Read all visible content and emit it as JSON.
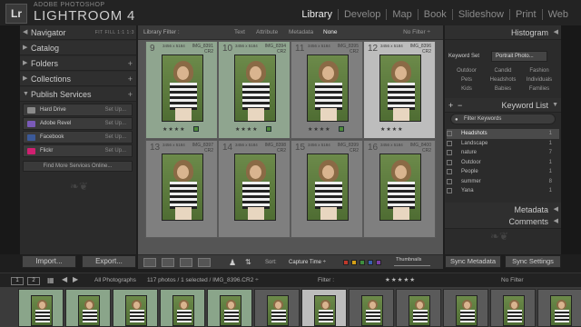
{
  "app": {
    "brand_small": "ADOBE PHOTOSHOP",
    "brand_big": "LIGHTROOM 4",
    "logo": "Lr"
  },
  "modules": [
    "Library",
    "Develop",
    "Map",
    "Book",
    "Slideshow",
    "Print",
    "Web"
  ],
  "active_module": "Library",
  "left_panel": {
    "navigator": {
      "label": "Navigator",
      "options": "FIT   FILL   1:1   1:3"
    },
    "catalog": "Catalog",
    "folders": "Folders",
    "collections": "Collections",
    "publish_services": "Publish Services",
    "services": [
      {
        "name": "Hard Drive",
        "setup": "Set Up...",
        "color": "#8a8a8a"
      },
      {
        "name": "Adobe Revel",
        "setup": "Set Up...",
        "color": "#7a5ab8"
      },
      {
        "name": "Facebook",
        "setup": "Set Up...",
        "color": "#3b5998"
      },
      {
        "name": "Flickr",
        "setup": "Set Up...",
        "color": "#d02070"
      }
    ],
    "find_more": "Find More Services Online...",
    "import": "Import...",
    "export": "Export..."
  },
  "filter_bar": {
    "label": "Library Filter :",
    "tabs": [
      "Text",
      "Attribute",
      "Metadata",
      "None"
    ],
    "active": "None",
    "no_filter": "No Filter ÷"
  },
  "grid": [
    {
      "num": "9",
      "meta": "3456 x 5184",
      "name": "IMG_8391",
      "ext": "CR2",
      "stars": "★★★★",
      "flag": true,
      "style": "green"
    },
    {
      "num": "10",
      "meta": "3456 x 5184",
      "name": "IMG_8394",
      "ext": "CR2",
      "stars": "★★★★",
      "flag": true,
      "style": "green"
    },
    {
      "num": "11",
      "meta": "3456 x 5184",
      "name": "IMG_8395",
      "ext": "CR2",
      "stars": "★★★★",
      "flag": true,
      "style": "normal"
    },
    {
      "num": "12",
      "meta": "3456 x 5184",
      "name": "IMG_8396",
      "ext": "CR2",
      "stars": "★★★★",
      "flag": false,
      "style": "sel"
    },
    {
      "num": "13",
      "meta": "3456 x 5184",
      "name": "IMG_8397",
      "ext": "CR2",
      "stars": "",
      "flag": false,
      "style": "normal"
    },
    {
      "num": "14",
      "meta": "3456 x 5184",
      "name": "IMG_8398",
      "ext": "CR2",
      "stars": "",
      "flag": false,
      "style": "normal"
    },
    {
      "num": "15",
      "meta": "3456 x 5184",
      "name": "IMG_8399",
      "ext": "CR2",
      "stars": "",
      "flag": false,
      "style": "normal"
    },
    {
      "num": "16",
      "meta": "3456 x 5184",
      "name": "IMG_8400",
      "ext": "CR2",
      "stars": "",
      "flag": false,
      "style": "normal"
    }
  ],
  "toolbar": {
    "sort_label": "Sort:",
    "sort_value": "Capture Time ÷",
    "thumbnails": "Thumbnails",
    "swatches": [
      "#c0392b",
      "#d4a017",
      "#3e8e3e",
      "#3a5fb0",
      "#7d3fa8"
    ]
  },
  "right_panel": {
    "histogram": "Histogram",
    "keyword_set_label": "Keyword Set",
    "keyword_set_value": "Portrait Photo...",
    "keyword_grid": [
      "Outdoor",
      "Candid",
      "Fashion",
      "Pets",
      "Headshots",
      "Individuals",
      "Kids",
      "Babies",
      "Families"
    ],
    "keyword_list": "Keyword List",
    "filter_keywords": "Filter Keywords",
    "keywords": [
      {
        "label": "Headshots",
        "count": "1",
        "highlight": true
      },
      {
        "label": "Landscape",
        "count": "1",
        "highlight": false
      },
      {
        "label": "nature",
        "count": "7",
        "highlight": false
      },
      {
        "label": "Outdoor",
        "count": "1",
        "highlight": false
      },
      {
        "label": "People",
        "count": "1",
        "highlight": false
      },
      {
        "label": "summer",
        "count": "8",
        "highlight": false
      },
      {
        "label": "Yana",
        "count": "1",
        "highlight": false
      }
    ],
    "metadata": "Metadata",
    "comments": "Comments",
    "sync_metadata": "Sync Metadata",
    "sync_settings": "Sync Settings"
  },
  "filmstrip_bar": {
    "monitor1": "1",
    "monitor2": "2",
    "source": "All Photographs",
    "status": "117 photos / 1 selected / IMG_8396.CR2 ÷",
    "filter": "Filter :",
    "no_filter": "No Filter"
  },
  "filmstrip": [
    {
      "style": "green"
    },
    {
      "style": "green"
    },
    {
      "style": "green"
    },
    {
      "style": "green"
    },
    {
      "style": "green"
    },
    {
      "style": "normal"
    },
    {
      "style": "sel"
    },
    {
      "style": "normal"
    },
    {
      "style": "normal"
    },
    {
      "style": "normal"
    },
    {
      "style": "normal"
    },
    {
      "style": "normal"
    }
  ]
}
